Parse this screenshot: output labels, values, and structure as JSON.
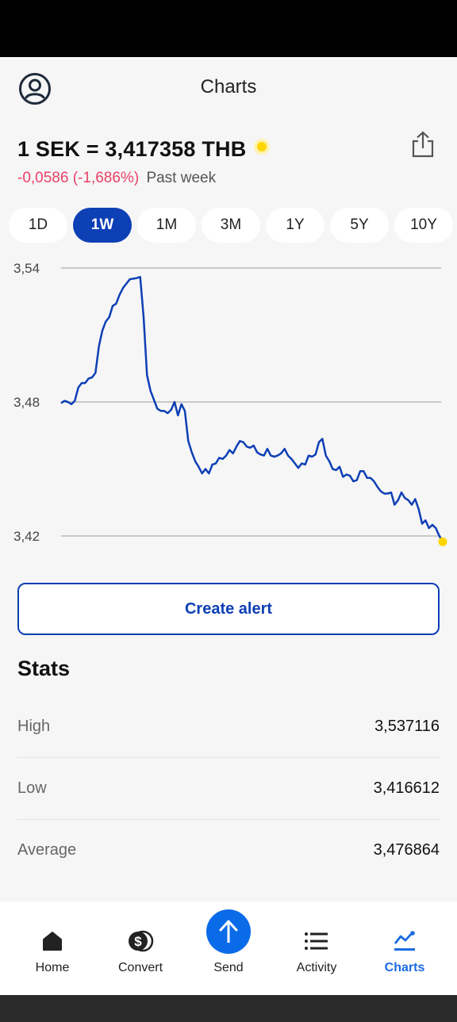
{
  "header": {
    "title": "Charts"
  },
  "rate": {
    "text": "1 SEK = 3,417358 THB",
    "change": "-0,0586 (-1,686%)",
    "period": "Past week"
  },
  "periods": [
    {
      "label": "1D",
      "active": false
    },
    {
      "label": "1W",
      "active": true
    },
    {
      "label": "1M",
      "active": false
    },
    {
      "label": "3M",
      "active": false
    },
    {
      "label": "1Y",
      "active": false
    },
    {
      "label": "5Y",
      "active": false
    },
    {
      "label": "10Y",
      "active": false
    }
  ],
  "chart_data": {
    "type": "line",
    "ylim": [
      3.42,
      3.54
    ],
    "ytick_labels": [
      "3,54",
      "3,48",
      "3,42"
    ],
    "yticks": [
      3.54,
      3.48,
      3.42
    ],
    "grid": true,
    "line_color": "#0d3fb5",
    "marker_color": "#ffd500",
    "series": [
      {
        "values": [
          3.4795,
          3.4805,
          3.48,
          3.479,
          3.4805,
          3.4865,
          3.4885,
          3.4885,
          3.4905,
          3.491,
          3.493,
          3.505,
          3.512,
          3.516,
          3.518,
          3.523,
          3.524,
          3.528,
          3.531,
          3.533,
          3.535,
          3.5352,
          3.5355,
          3.536,
          3.518,
          3.492,
          3.485,
          3.481,
          3.477,
          3.476,
          3.476,
          3.475,
          3.4765,
          3.48,
          3.474,
          3.479,
          3.476,
          3.4625,
          3.4575,
          3.4535,
          3.451,
          3.448,
          3.45,
          3.448,
          3.452,
          3.4525,
          3.455,
          3.4545,
          3.456,
          3.4585,
          3.457,
          3.46,
          3.4625,
          3.462,
          3.46,
          3.4595,
          3.4605,
          3.4575,
          3.4565,
          3.456,
          3.459,
          3.456,
          3.4555,
          3.456,
          3.457,
          3.459,
          3.456,
          3.4545,
          3.4525,
          3.4505,
          3.4525,
          3.452,
          3.456,
          3.4555,
          3.4565,
          3.462,
          3.4635,
          3.456,
          3.4535,
          3.45,
          3.4495,
          3.451,
          3.4465,
          3.4475,
          3.447,
          3.4445,
          3.445,
          3.449,
          3.449,
          3.446,
          3.446,
          3.4445,
          3.442,
          3.44,
          3.439,
          3.439,
          3.4395,
          3.434,
          3.436,
          3.4395,
          3.437,
          3.436,
          3.434,
          3.4365,
          3.432,
          3.4255,
          3.427,
          3.4235,
          3.425,
          3.4235,
          3.42,
          3.4174
        ]
      }
    ]
  },
  "alert": {
    "label": "Create alert"
  },
  "stats": {
    "title": "Stats",
    "rows": [
      {
        "label": "High",
        "value": "3,537116"
      },
      {
        "label": "Low",
        "value": "3,416612"
      },
      {
        "label": "Average",
        "value": "3,476864"
      }
    ]
  },
  "nav": {
    "items": [
      {
        "label": "Home",
        "icon": "home-icon",
        "active": false
      },
      {
        "label": "Convert",
        "icon": "convert-icon",
        "active": false
      },
      {
        "label": "Send",
        "icon": "send-icon",
        "active": false
      },
      {
        "label": "Activity",
        "icon": "activity-icon",
        "active": false
      },
      {
        "label": "Charts",
        "icon": "charts-icon",
        "active": true
      }
    ]
  },
  "colors": {
    "accent": "#0d3fb5",
    "negative": "#e8416a",
    "live_dot": "#ffd500",
    "nav_active": "#1a6be0",
    "send_button": "#0a6be8"
  }
}
